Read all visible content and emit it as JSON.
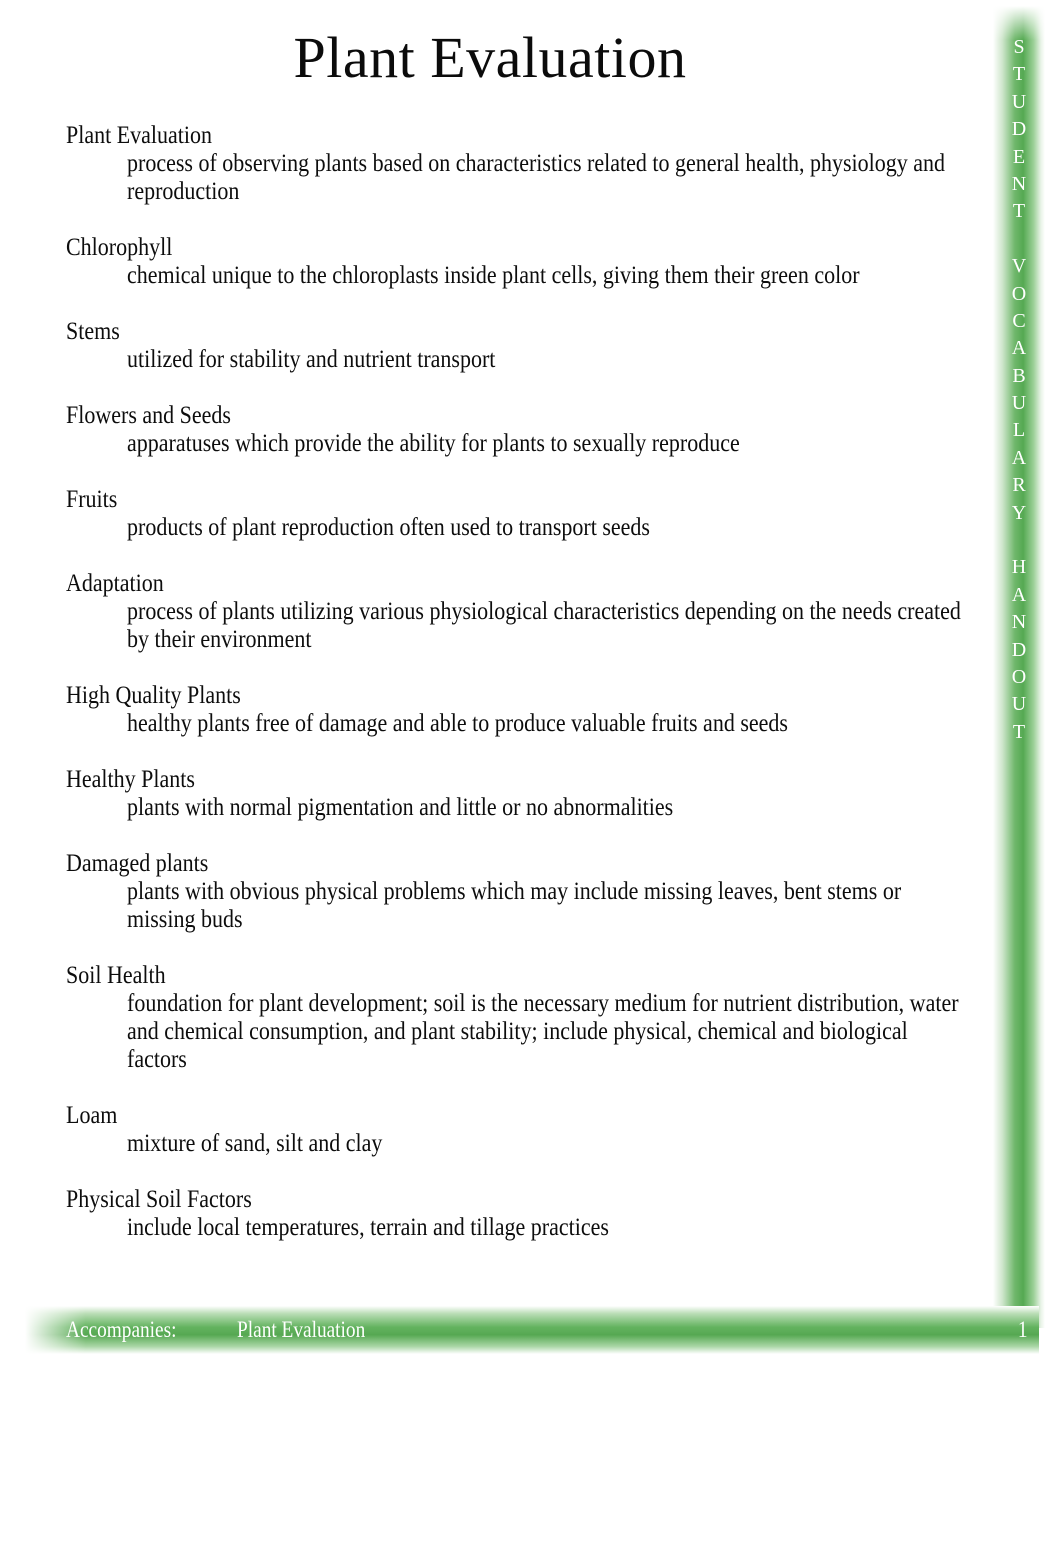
{
  "document": {
    "title": "Plant Evaluation"
  },
  "side_band": {
    "text": "STUDENT VOCABULARY HANDOUT",
    "letters": [
      "S",
      "T",
      "U",
      "D",
      "E",
      "N",
      "T",
      " ",
      "V",
      "O",
      "C",
      "A",
      "B",
      "U",
      "L",
      "A",
      "R",
      "Y",
      " ",
      "H",
      "A",
      "N",
      "D",
      "O",
      "U",
      "T"
    ],
    "color": "#55a952",
    "text_color": "#ffffff"
  },
  "glossary": {
    "entries": [
      {
        "term": "Plant Evaluation",
        "definition": "process of observing plants based on characteristics related to general health, physiology and reproduction"
      },
      {
        "term": "Chlorophyll",
        "definition": "chemical unique to the chloroplasts inside plant cells, giving them their green color"
      },
      {
        "term": "Stems",
        "definition": "utilized for stability and nutrient transport"
      },
      {
        "term": "Flowers and Seeds",
        "definition": "apparatuses which provide the ability for plants to sexually reproduce"
      },
      {
        "term": "Fruits",
        "definition": "products of plant reproduction often used to transport seeds"
      },
      {
        "term": "Adaptation",
        "definition": "process of plants utilizing various physiological characteristics depending on the needs created by their environment"
      },
      {
        "term": "High Quality Plants",
        "definition": "healthy plants free of damage and able to produce valuable fruits and seeds"
      },
      {
        "term": "Healthy Plants",
        "definition": "plants with normal pigmentation and little or no abnormalities"
      },
      {
        "term": "Damaged plants",
        "definition": "plants with obvious physical problems which may include missing leaves, bent stems or missing buds"
      },
      {
        "term": "Soil Health",
        "definition": "foundation for plant development; soil is the necessary medium for nutrient distribution, water and chemical consumption, and plant stability; include physical, chemical and biological factors"
      },
      {
        "term": "Loam",
        "definition": "mixture of sand, silt and clay"
      },
      {
        "term": "Physical Soil Factors",
        "definition": "include local temperatures, terrain and tillage practices"
      }
    ]
  },
  "footer": {
    "label": "Accompanies:",
    "document_name": "Plant Evaluation",
    "page_number": "1",
    "bar_color": "#56a852",
    "text_color": "#ffffff"
  }
}
